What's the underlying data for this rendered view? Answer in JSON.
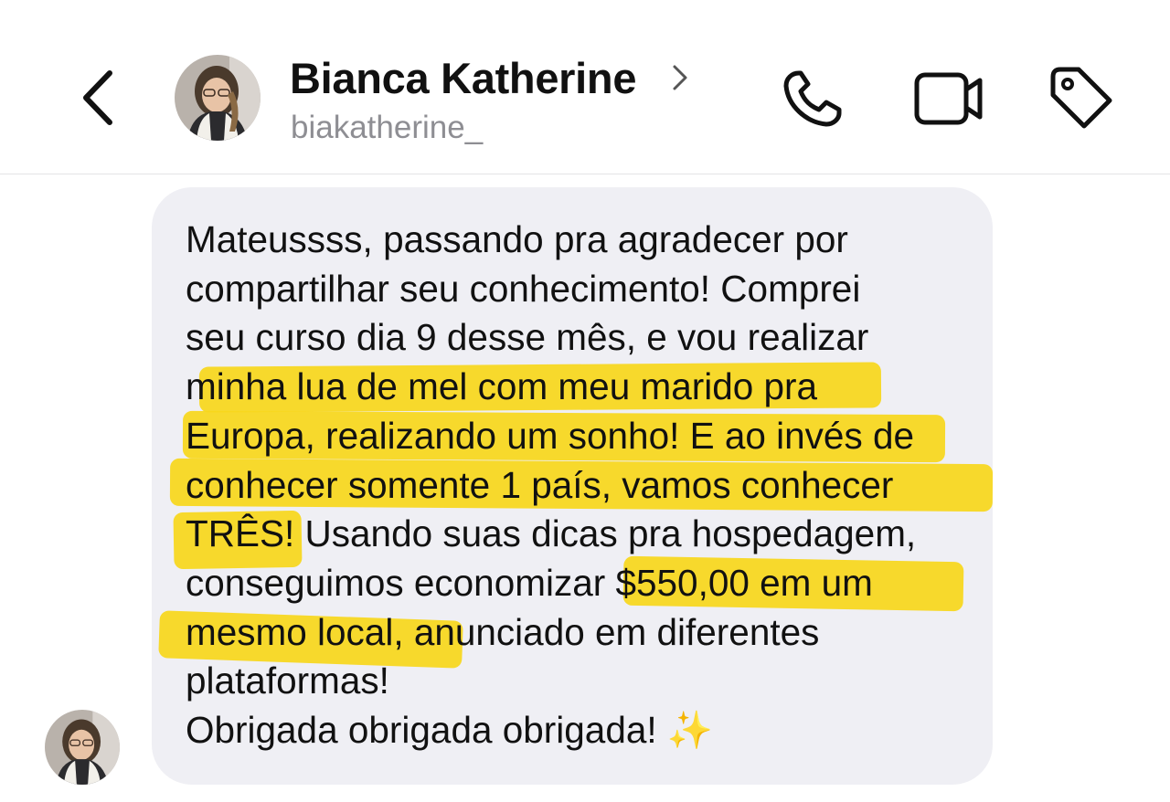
{
  "header": {
    "contact_name": "Bianca Katherine",
    "contact_handle": "biakatherine_",
    "icons": {
      "back": "chevron-left-icon",
      "profile": "chevron-right-icon",
      "call": "phone-icon",
      "video": "video-camera-icon",
      "label": "tag-icon"
    }
  },
  "message": {
    "text": "Mateussss, passando pra agradecer por\ncompartilhar seu conhecimento! Comprei\nseu curso dia 9 desse mês, e vou realizar\nminha lua de mel com meu marido pra\nEuropa, realizando um sonho! E ao invés de\nconhecer somente 1 país, vamos conhecer\nTRÊS! Usando suas dicas pra hospedagem,\nconseguimos economizar $550,00 em um\nmesmo local, anunciado em diferentes\nplataformas!\nObrigada obrigada obrigada! ✨",
    "highlight_color": "#f7d71a",
    "bubble_color": "#efeff4"
  }
}
